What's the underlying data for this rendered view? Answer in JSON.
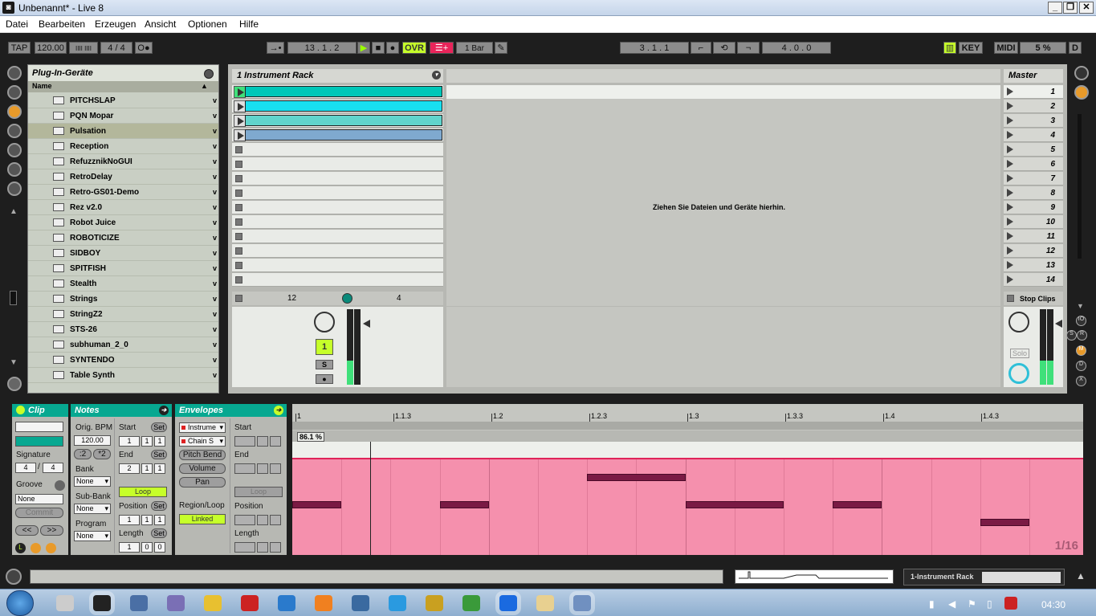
{
  "window": {
    "title": "Unbenannt* - Live 8",
    "min": "_",
    "max": "❐",
    "close": "✕"
  },
  "menu": [
    "Datei",
    "Bearbeiten",
    "Erzeugen",
    "Ansicht",
    "Optionen",
    "Hilfe"
  ],
  "transport": {
    "tap": "TAP",
    "tempo": "120.00",
    "nudge": "IIII IIII",
    "signature": "4 / 4",
    "metro": "O●",
    "follow": "→•",
    "position": "13 . 1 . 2",
    "ovr": "OVR",
    "quantize": "1 Bar",
    "loop_start": "3 . 1 . 1",
    "loop_length": "4 . 0 . 0",
    "key": "KEY",
    "midi": "MIDI",
    "cpu": "5 %",
    "disk": "D"
  },
  "browser": {
    "title": "Plug-In-Geräte",
    "column": "Name",
    "items": [
      "PITCHSLAP",
      "PQN Mopar",
      "Pulsation",
      "Reception",
      "RefuzznikNoGUI",
      "RetroDelay",
      "Retro-GS01-Demo",
      "Rez v2.0",
      "Robot Juice",
      "ROBOTICIZE",
      "SIDBOY",
      "SPITFISH",
      "Stealth",
      "Strings",
      "StringZ2",
      "STS-26",
      "subhuman_2_0",
      "SYNTENDO",
      "Table Synth"
    ],
    "selected_index": 2,
    "chevron": "v"
  },
  "session": {
    "track_name": "1 Instrument Rack",
    "drop_hint": "Ziehen Sie Dateien und Geräte hierhin.",
    "master_name": "Master",
    "scenes": [
      "1",
      "2",
      "3",
      "4",
      "5",
      "6",
      "7",
      "8",
      "9",
      "10",
      "11",
      "12",
      "13",
      "14"
    ],
    "stop_clips": "Stop Clips",
    "io_left": "12",
    "io_right": "4",
    "track_number": "1",
    "solo_s": "S",
    "solo_label": "Solo",
    "clip_colors": [
      "#00c7b8",
      "#18e0f0",
      "#60d4cc",
      "#7fa9cf"
    ]
  },
  "clip_panel": {
    "title": "Clip",
    "signature_label": "Signature",
    "sig_num": "4",
    "sig_den": "4",
    "groove_label": "Groove",
    "groove_value": "None",
    "commit": "Commit",
    "prev": "<<",
    "next": ">>"
  },
  "notes_panel": {
    "title": "Notes",
    "orig_bpm_label": "Orig. BPM",
    "orig_bpm": "120.00",
    "half": ":2",
    "double": "*2",
    "bank_label": "Bank",
    "bank_value": "None",
    "subbank_label": "Sub-Bank",
    "subbank_value": "None",
    "program_label": "Program",
    "program_value": "None",
    "start_label": "Start",
    "end_label": "End",
    "set": "Set",
    "start": [
      "1",
      "1",
      "1"
    ],
    "end": [
      "2",
      "1",
      "1"
    ],
    "loop": "Loop",
    "position_label": "Position",
    "position": [
      "1",
      "1",
      "1"
    ],
    "length_label": "Length",
    "length": [
      "1",
      "0",
      "0"
    ]
  },
  "env_panel": {
    "title": "Envelopes",
    "device": "Instrume",
    "chain": "Chain S",
    "pitch_bend": "Pitch Bend",
    "volume": "Volume",
    "pan": "Pan",
    "region_label": "Region/Loop",
    "linked": "Linked",
    "start_label": "Start",
    "end_label": "End",
    "loop": "Loop",
    "position_label": "Position",
    "length_label": "Length"
  },
  "piano_roll": {
    "ruler": [
      "1",
      "1.1.3",
      "1.2",
      "1.2.3",
      "1.3",
      "1.3.3",
      "1.4",
      "1.4.3"
    ],
    "velocity_readout": "86.1 %",
    "grid": "1/16"
  },
  "status": {
    "device_name": "1-Instrument Rack"
  },
  "taskbar": {
    "clock": "04:30"
  }
}
